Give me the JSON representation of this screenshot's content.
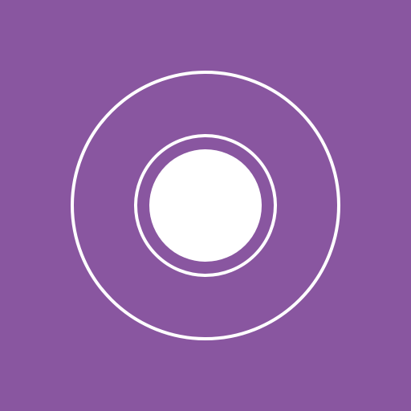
{
  "icon": {
    "name": "concentric-circles-icon",
    "background_color": "#8956a0",
    "foreground_color": "#ffffff"
  }
}
